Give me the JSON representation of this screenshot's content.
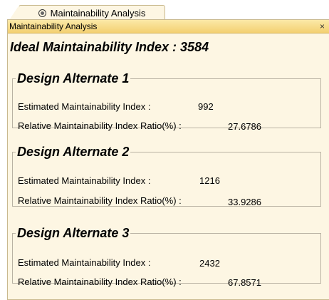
{
  "tab": {
    "label": "Maintainability Analysis",
    "icon": "analysis-icon"
  },
  "panel": {
    "title": "Maintainability Analysis",
    "close_label": "×"
  },
  "ideal": {
    "text": "Ideal Maintainability Index : 3584"
  },
  "alternates": [
    {
      "title": "Design Alternate 1",
      "estimated_label": "Estimated Maintainability Index :",
      "estimated_value": "992",
      "ratio_label": "Relative Maintainability Index Ratio(%) :",
      "ratio_value": "27.6786"
    },
    {
      "title": "Design Alternate 2",
      "estimated_label": "Estimated Maintainability Index :",
      "estimated_value": "1216",
      "ratio_label": "Relative Maintainability Index Ratio(%) :",
      "ratio_value": "33.9286"
    },
    {
      "title": "Design Alternate 3",
      "estimated_label": "Estimated Maintainability Index :",
      "estimated_value": "2432",
      "ratio_label": "Relative Maintainability Index Ratio(%) :",
      "ratio_value": "67.8571"
    }
  ],
  "colors": {
    "panel_bg": "#fdf6e3",
    "titlebar": "#f3d071",
    "border": "#c9b98e"
  }
}
